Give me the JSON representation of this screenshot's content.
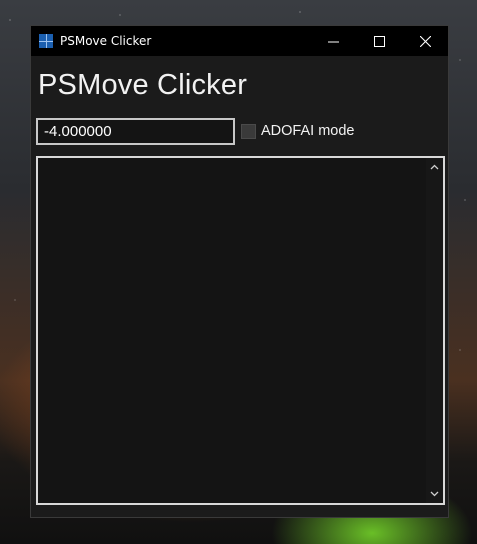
{
  "window": {
    "title": "PSMove Clicker",
    "minimize_glyph": "—",
    "maximize_glyph": "☐",
    "close_glyph": "✕"
  },
  "main": {
    "heading": "PSMove Clicker",
    "offset_value": "-4.000000",
    "adofai_label": "ADOFAI mode",
    "adofai_checked": false,
    "scroll_up_glyph": "▲",
    "scroll_down_glyph": "▼"
  }
}
